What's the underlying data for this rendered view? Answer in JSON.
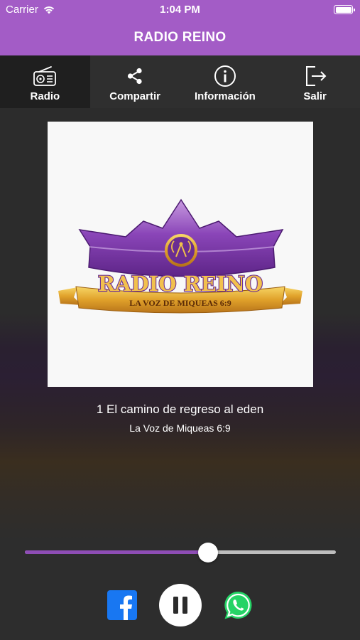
{
  "status_bar": {
    "carrier": "Carrier",
    "time": "1:04 PM"
  },
  "header": {
    "title": "RADIO REINO",
    "color": "#a35cc6"
  },
  "tabs": [
    {
      "label": "Radio",
      "icon": "radio-icon",
      "active": true
    },
    {
      "label": "Compartir",
      "icon": "share-icon",
      "active": false
    },
    {
      "label": "Información",
      "icon": "info-icon",
      "active": false
    },
    {
      "label": "Salir",
      "icon": "exit-icon",
      "active": false
    }
  ],
  "artwork": {
    "logo_text": "RADIO REINO",
    "logo_subtitle": "LA VOZ DE MIQUEAS 6:9"
  },
  "now_playing": {
    "title": "1 El camino de regreso al eden",
    "subtitle": "La Voz de Miqueas 6:9"
  },
  "volume": {
    "level": 0.59,
    "accent_color": "#8e4db5"
  },
  "controls": {
    "share_facebook": "facebook-icon",
    "play_pause": "pause-icon",
    "share_whatsapp": "whatsapp-icon"
  }
}
